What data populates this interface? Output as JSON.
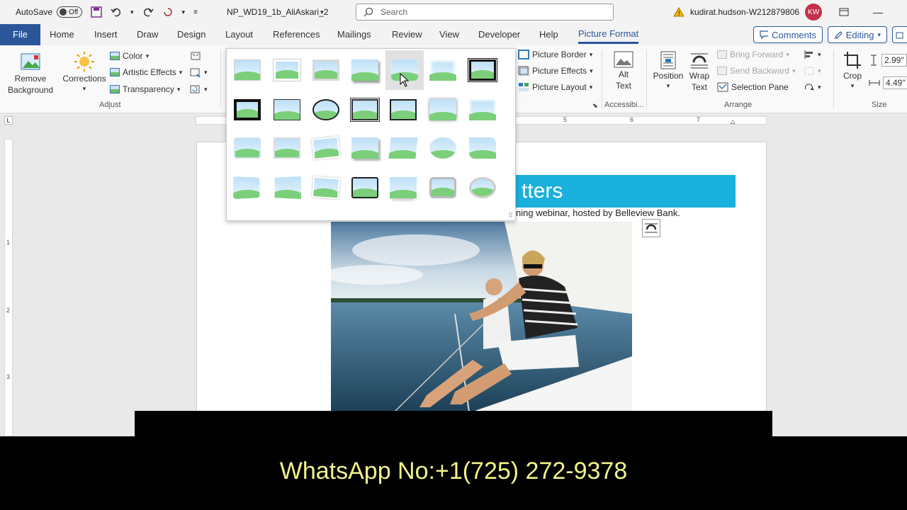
{
  "titlebar": {
    "autosave_label": "AutoSave",
    "autosave_state": "Off",
    "doc_name": "NP_WD19_1b_AliAskari_2",
    "search_placeholder": "Search",
    "user": "kudirat.hudson-W212879806",
    "initials": "KW"
  },
  "tabs": {
    "file": "File",
    "home": "Home",
    "insert": "Insert",
    "draw": "Draw",
    "design": "Design",
    "layout": "Layout",
    "references": "References",
    "mailings": "Mailings",
    "review": "Review",
    "view": "View",
    "developer": "Developer",
    "help": "Help",
    "picture_format": "Picture Format"
  },
  "topright": {
    "comments": "Comments",
    "editing": "Editing"
  },
  "ribbon": {
    "remove_bg_1": "Remove",
    "remove_bg_2": "Background",
    "corrections": "Corrections",
    "color": "Color",
    "artistic": "Artistic Effects",
    "transparency": "Transparency",
    "adjust": "Adjust",
    "picture_border": "Picture Border",
    "picture_effects": "Picture Effects",
    "picture_layout": "Picture Layout",
    "alt_1": "Alt",
    "alt_2": "Text",
    "accessibility": "Accessibi...",
    "position": "Position",
    "wrap_1": "Wrap",
    "wrap_2": "Text",
    "bring_forward": "Bring Forward",
    "send_backward": "Send Backward",
    "selection_pane": "Selection Pane",
    "arrange": "Arrange",
    "crop": "Crop",
    "height": "2.99\"",
    "width": "4.49\"",
    "size": "Size"
  },
  "ruler": {
    "t5": "5",
    "t6": "6",
    "t7": "7",
    "v1": "1",
    "v2": "2",
    "v3": "3"
  },
  "document": {
    "heading_fragment": "tters",
    "body_fragment": "ning webinar, hosted by Belleview Bank."
  },
  "caption": "WhatsApp No:+1(725) 272-9378"
}
